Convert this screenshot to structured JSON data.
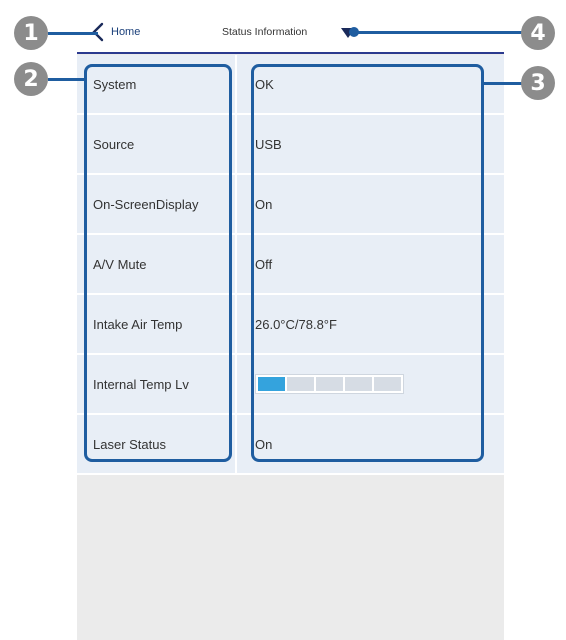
{
  "header": {
    "home_label": "Home",
    "title": "Status Information",
    "back_icon": "chevron-left-icon",
    "signal_icon": "wifi-signal-icon"
  },
  "rows": [
    {
      "label": "System",
      "value": "OK"
    },
    {
      "label": "Source",
      "value": "USB"
    },
    {
      "label": "On-ScreenDisplay",
      "value": "On"
    },
    {
      "label": "A/V Mute",
      "value": "Off"
    },
    {
      "label": "Intake Air Temp",
      "value": "26.0°C/78.8°F"
    },
    {
      "label": "Internal Temp Lv",
      "value": null,
      "level": 1,
      "level_max": 5
    },
    {
      "label": "Laser Status",
      "value": "On"
    }
  ],
  "callouts": [
    "1",
    "2",
    "3",
    "4"
  ],
  "colors": {
    "accent": "#1f5da0",
    "header_rule": "#2b3a8f",
    "cell_bg": "#e8eef6",
    "level_fill": "#34a3dd",
    "badge": "#8c8c8c"
  }
}
